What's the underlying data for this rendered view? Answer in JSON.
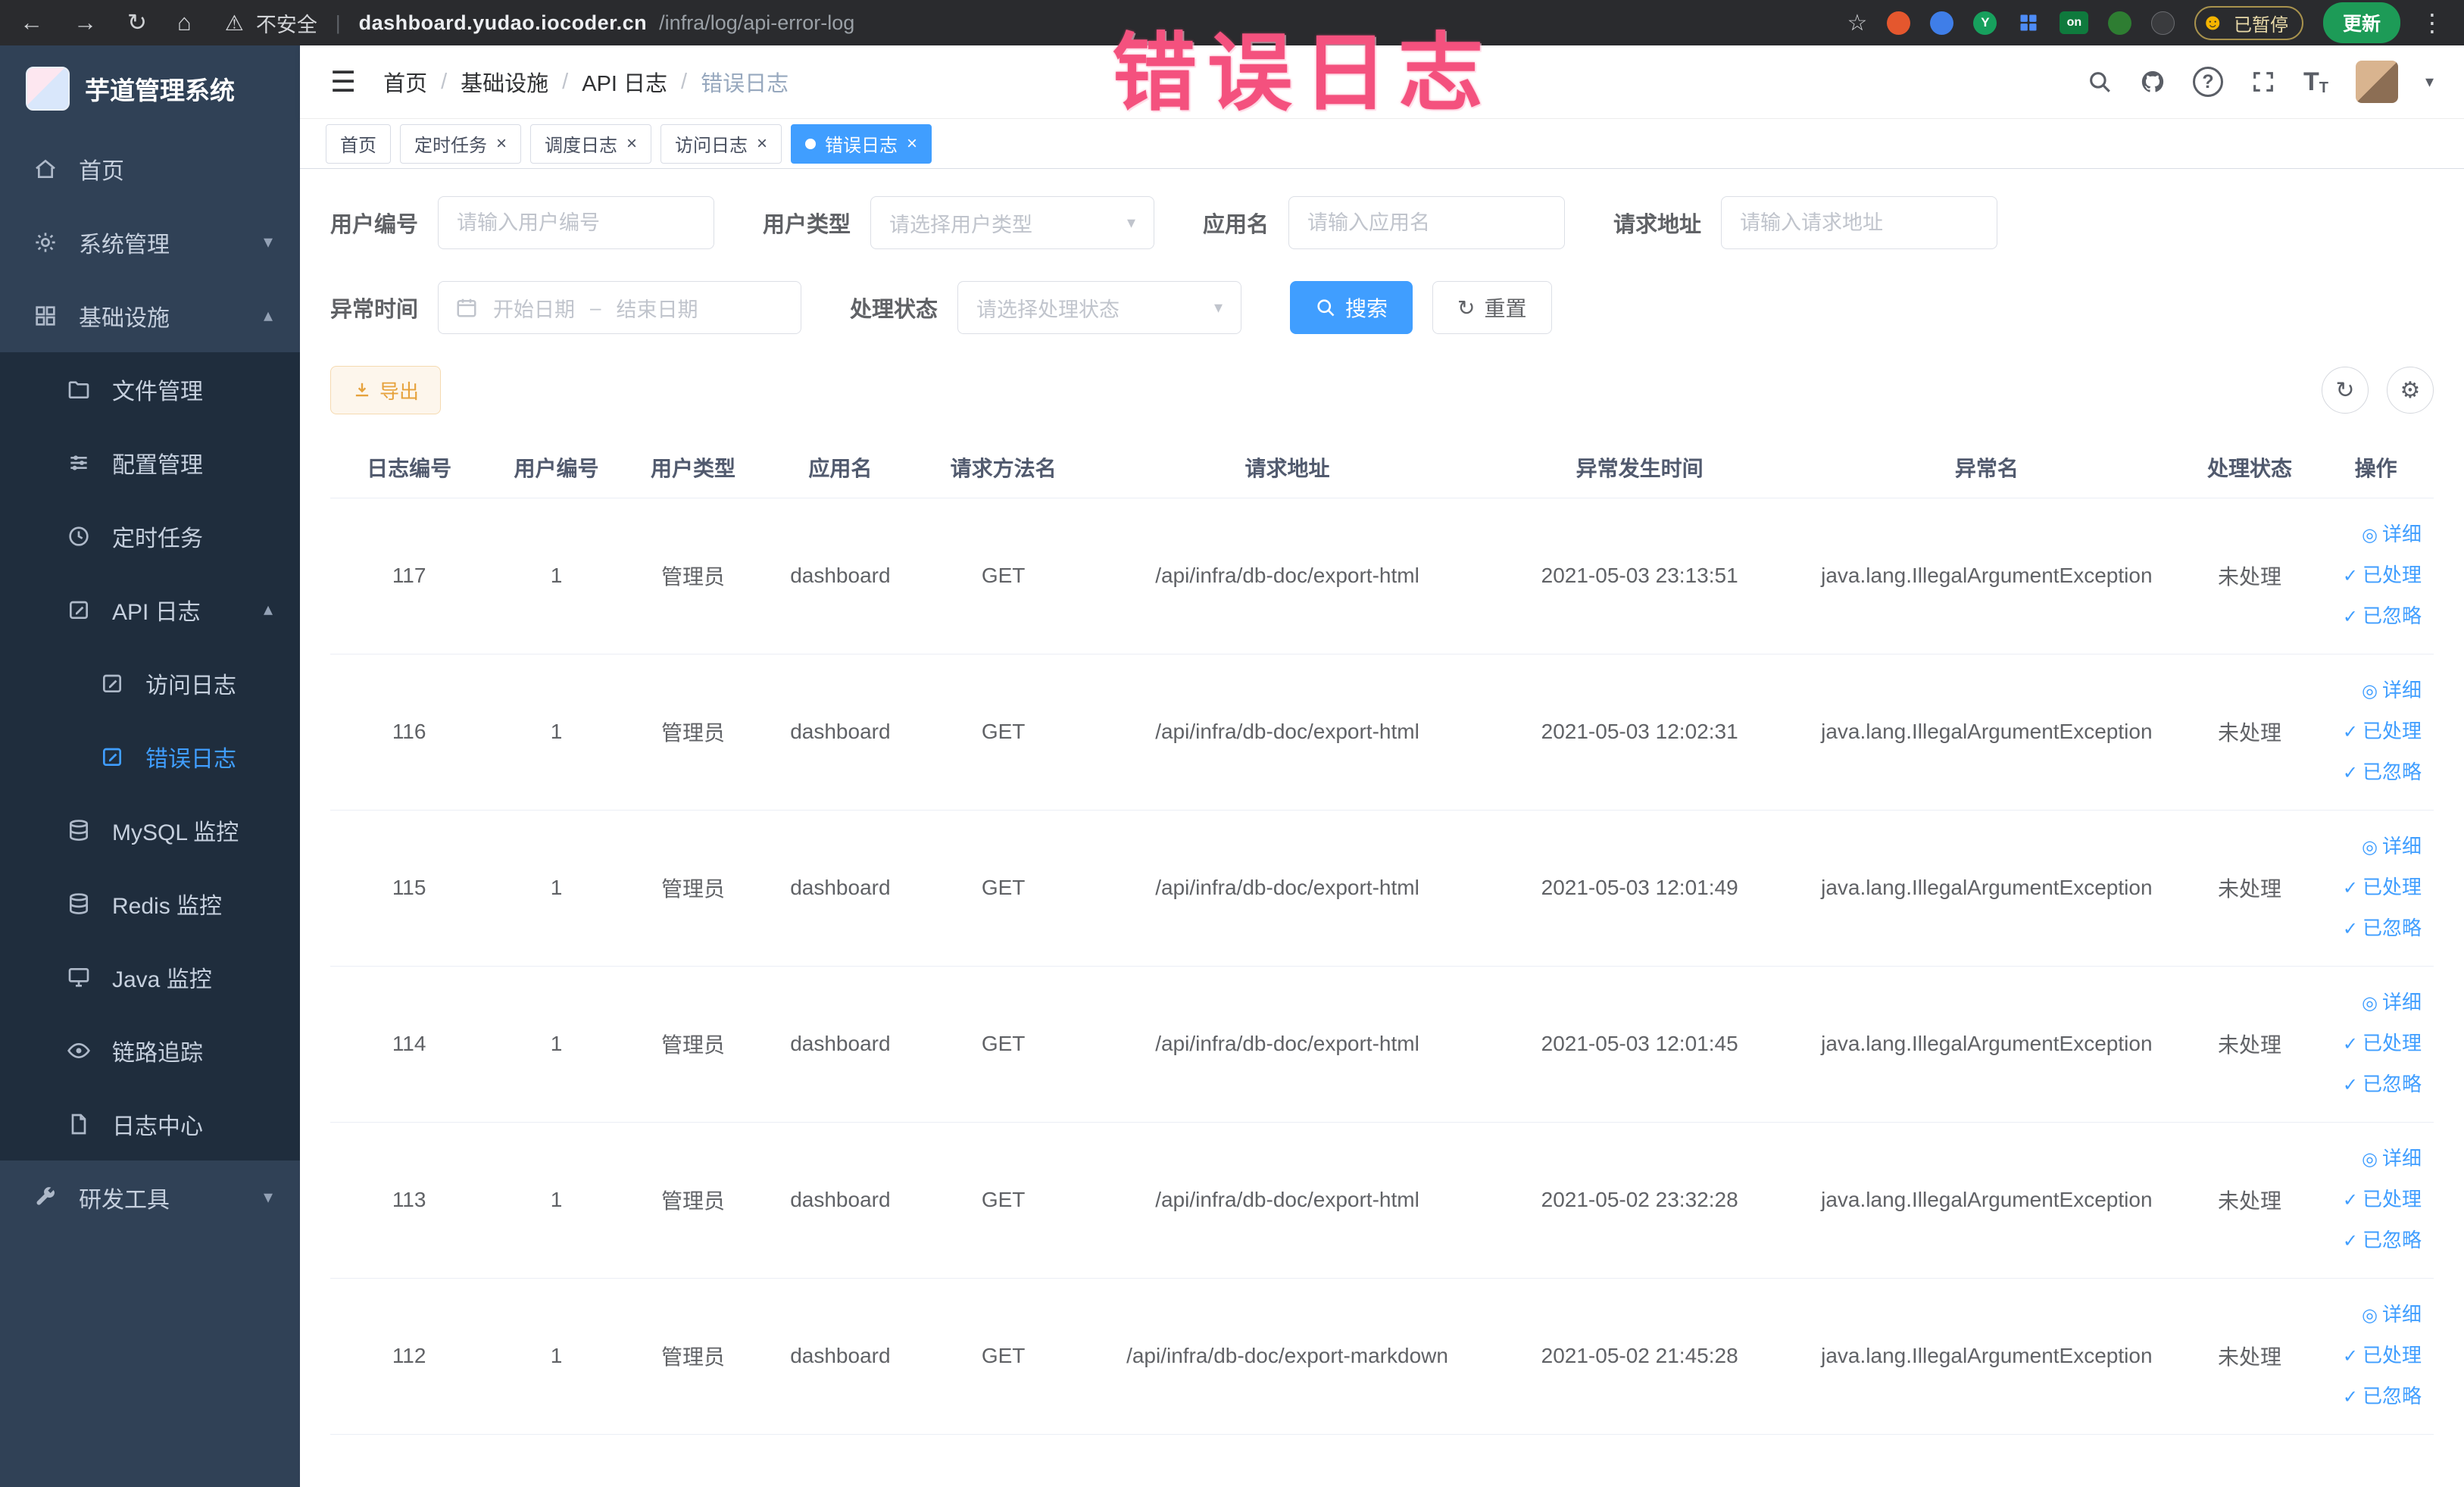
{
  "browser": {
    "security_label": "不安全",
    "url_host": "dashboard.yudao.iocoder.cn",
    "url_path": "/infra/log/api-error-log",
    "extension_y_label": "Y",
    "extension_on_label": "on",
    "paused_badge": "已暂停",
    "update_button": "更新"
  },
  "watermark": {
    "text": "错误日志",
    "color": "#f4517e"
  },
  "sidebar": {
    "app_title": "芋道管理系统",
    "home": "首页",
    "system": "系统管理",
    "infra": "基础设施",
    "file": "文件管理",
    "config": "配置管理",
    "task": "定时任务",
    "api_log": "API 日志",
    "access_log": "访问日志",
    "error_log": "错误日志",
    "mysql": "MySQL 监控",
    "redis": "Redis 监控",
    "java": "Java 监控",
    "trace": "链路追踪",
    "log_center": "日志中心",
    "dev_tools": "研发工具"
  },
  "header": {
    "breadcrumb": [
      "首页",
      "基础设施",
      "API 日志",
      "错误日志"
    ]
  },
  "tabs": [
    {
      "label": "首页"
    },
    {
      "label": "定时任务"
    },
    {
      "label": "调度日志"
    },
    {
      "label": "访问日志"
    },
    {
      "label": "错误日志"
    }
  ],
  "filters": {
    "user_id_label": "用户编号",
    "user_id_placeholder": "请输入用户编号",
    "user_type_label": "用户类型",
    "user_type_placeholder": "请选择用户类型",
    "app_name_label": "应用名",
    "app_name_placeholder": "请输入应用名",
    "request_url_label": "请求地址",
    "request_url_placeholder": "请输入请求地址",
    "exception_time_label": "异常时间",
    "start_placeholder": "开始日期",
    "range_separator": "–",
    "end_placeholder": "结束日期",
    "status_label": "处理状态",
    "status_placeholder": "请选择处理状态",
    "search_button": "搜索",
    "reset_button": "重置"
  },
  "toolbar": {
    "export_button": "导出"
  },
  "table": {
    "columns": [
      "日志编号",
      "用户编号",
      "用户类型",
      "应用名",
      "请求方法名",
      "请求地址",
      "异常发生时间",
      "异常名",
      "处理状态",
      "操作"
    ],
    "actions": [
      "详细",
      "已处理",
      "已忽略"
    ],
    "rows": [
      {
        "id": "117",
        "user_id": "1",
        "user_type": "管理员",
        "app": "dashboard",
        "method": "GET",
        "url": "/api/infra/db-doc/export-html",
        "time": "2021-05-03 23:13:51",
        "exception": "java.lang.IllegalArgumentException",
        "status": "未处理"
      },
      {
        "id": "116",
        "user_id": "1",
        "user_type": "管理员",
        "app": "dashboard",
        "method": "GET",
        "url": "/api/infra/db-doc/export-html",
        "time": "2021-05-03 12:02:31",
        "exception": "java.lang.IllegalArgumentException",
        "status": "未处理"
      },
      {
        "id": "115",
        "user_id": "1",
        "user_type": "管理员",
        "app": "dashboard",
        "method": "GET",
        "url": "/api/infra/db-doc/export-html",
        "time": "2021-05-03 12:01:49",
        "exception": "java.lang.IllegalArgumentException",
        "status": "未处理"
      },
      {
        "id": "114",
        "user_id": "1",
        "user_type": "管理员",
        "app": "dashboard",
        "method": "GET",
        "url": "/api/infra/db-doc/export-html",
        "time": "2021-05-03 12:01:45",
        "exception": "java.lang.IllegalArgumentException",
        "status": "未处理"
      },
      {
        "id": "113",
        "user_id": "1",
        "user_type": "管理员",
        "app": "dashboard",
        "method": "GET",
        "url": "/api/infra/db-doc/export-html",
        "time": "2021-05-02 23:32:28",
        "exception": "java.lang.IllegalArgumentException",
        "status": "未处理"
      },
      {
        "id": "112",
        "user_id": "1",
        "user_type": "管理员",
        "app": "dashboard",
        "method": "GET",
        "url": "/api/infra/db-doc/export-markdown",
        "time": "2021-05-02 21:45:28",
        "exception": "java.lang.IllegalArgumentException",
        "status": "未处理"
      }
    ]
  },
  "colors": {
    "primary": "#409eff",
    "sidebar_bg": "#304156",
    "submenu_bg": "#1f2d3d",
    "warning": "#e6a23c"
  },
  "icons": {
    "back": "←",
    "forward": "→",
    "reload": "↻",
    "home": "⌂",
    "warning": "⚠",
    "star": "☆",
    "kebab": "⋮",
    "hamburger": "☰",
    "caret_down": "▾",
    "chevron_down": "▾",
    "chevron_up": "▴",
    "close": "×",
    "refresh": "↻",
    "gear": "⚙",
    "detail_eye": "◎",
    "check": "✓",
    "question": "?",
    "separator": "|",
    "breadcrumb_separator": "/",
    "smiley": "☻",
    "font_size_big": "T",
    "font_size_small": "T"
  }
}
